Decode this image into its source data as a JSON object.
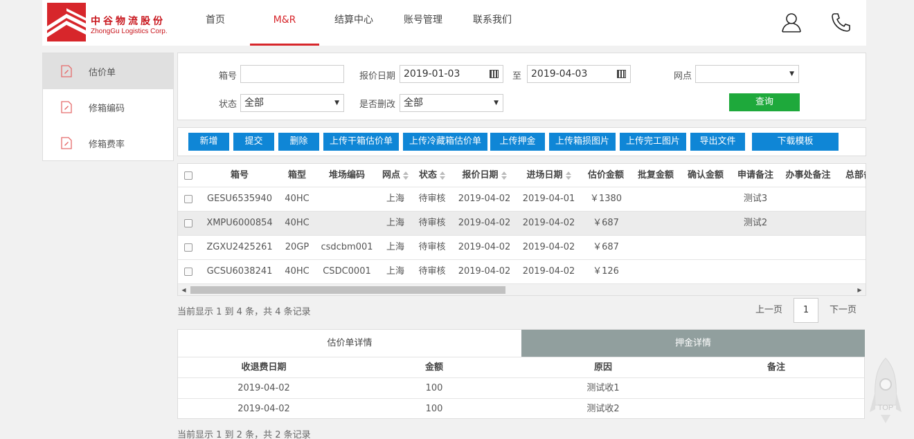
{
  "header": {
    "logo_cn": "中谷物流股份",
    "logo_en": "ZhongGu Logistics Corp.",
    "nav": [
      {
        "label": "首页",
        "active": false
      },
      {
        "label": "M&R",
        "active": true
      },
      {
        "label": "结算中心",
        "active": false
      },
      {
        "label": "账号管理",
        "active": false
      },
      {
        "label": "联系我们",
        "active": false
      }
    ],
    "icons": [
      "user-icon",
      "phone-icon"
    ]
  },
  "sidebar": {
    "items": [
      {
        "label": "估价单",
        "icon": "document-icon",
        "active": true
      },
      {
        "label": "修箱编码",
        "icon": "document-icon",
        "active": false
      },
      {
        "label": "修箱费率",
        "icon": "document-icon",
        "active": false
      }
    ]
  },
  "filter": {
    "box_no_label": "箱号",
    "box_no_value": "",
    "date_label": "报价日期",
    "date_from": "2019-01-03",
    "date_sep": "至",
    "date_to": "2019-04-03",
    "site_label": "网点",
    "site_value": "",
    "status_label": "状态",
    "status_value": "全部",
    "deleted_label": "是否删改",
    "deleted_value": "全部",
    "query_label": "查询"
  },
  "actions": [
    "新增",
    "提交",
    "删除",
    "上传干箱估价单",
    "上传冷藏箱估价单",
    "上传押金",
    "上传箱损图片",
    "上传完工图片",
    "导出文件",
    "下载模板"
  ],
  "table": {
    "columns": [
      "箱号",
      "箱型",
      "堆场编码",
      "网点",
      "状态",
      "报价日期",
      "进场日期",
      "估价金额",
      "批复金额",
      "确认金额",
      "申请备注",
      "办事处备注",
      "总部备注"
    ],
    "rows": [
      {
        "box": "GESU6535940",
        "type": "40HC",
        "yard": "",
        "site": "上海",
        "status": "待审核",
        "quote_date": "2019-04-02",
        "entry_date": "2019-04-01",
        "amount": "￥1380",
        "remark": "测试3"
      },
      {
        "box": "XMPU6000854",
        "type": "40HC",
        "yard": "",
        "site": "上海",
        "status": "待审核",
        "quote_date": "2019-04-02",
        "entry_date": "2019-04-02",
        "amount": "￥687",
        "remark": "测试2"
      },
      {
        "box": "ZGXU2425261",
        "type": "20GP",
        "yard": "csdcbm001",
        "site": "上海",
        "status": "待审核",
        "quote_date": "2019-04-02",
        "entry_date": "2019-04-02",
        "amount": "￥687",
        "remark": ""
      },
      {
        "box": "GCSU6038241",
        "type": "40HC",
        "yard": "CSDC0001",
        "site": "上海",
        "status": "待审核",
        "quote_date": "2019-04-02",
        "entry_date": "2019-04-02",
        "amount": "￥126",
        "remark": ""
      }
    ],
    "summary": "当前显示 1 到 4 条，共 4 条记录"
  },
  "pager": {
    "prev": "上一页",
    "page": "1",
    "next": "下一页"
  },
  "detail": {
    "tabs": [
      {
        "label": "估价单详情",
        "active": true
      },
      {
        "label": "押金详情",
        "active": false
      }
    ],
    "columns": [
      "收退费日期",
      "金额",
      "原因",
      "备注"
    ],
    "rows": [
      {
        "date": "2019-04-02",
        "amount": "100",
        "reason": "测试收1",
        "note": ""
      },
      {
        "date": "2019-04-02",
        "amount": "100",
        "reason": "测试收2",
        "note": ""
      }
    ],
    "summary": "当前显示 1 到 2 条，共 2 条记录"
  },
  "back_to_top": {
    "label": "TOP",
    "icon": "rocket-icon"
  },
  "colors": {
    "brand_red": "#d7262b",
    "action_blue": "#0f86d6",
    "query_green": "#1ea93b",
    "tab_gray": "#919f9e"
  }
}
